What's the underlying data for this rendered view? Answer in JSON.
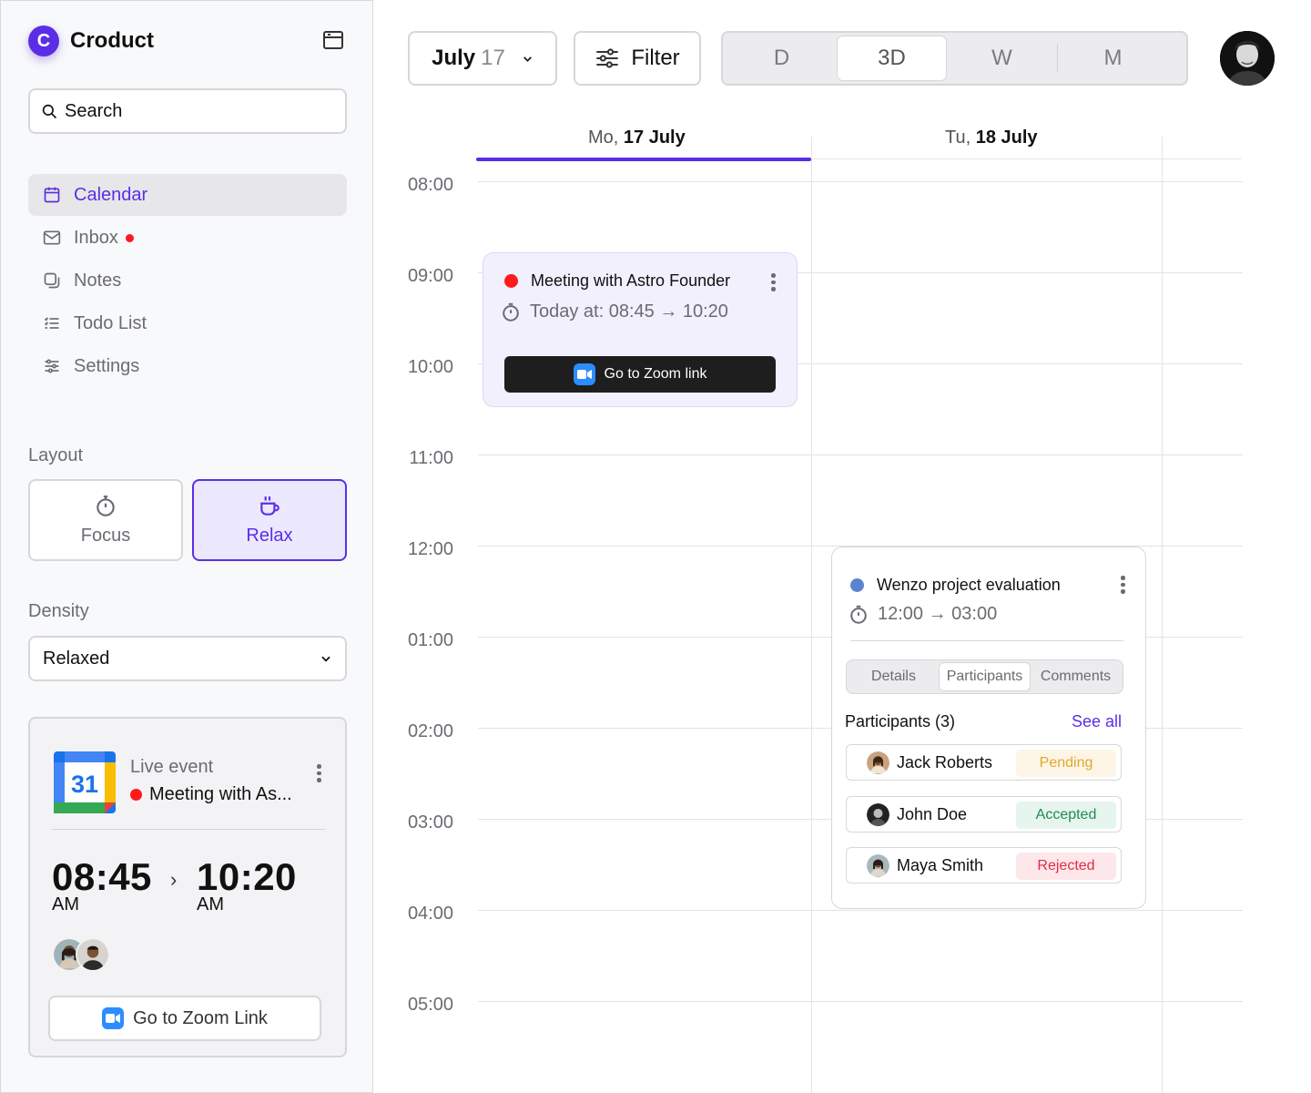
{
  "app": {
    "name": "Croduct",
    "logo_letter": "C"
  },
  "sidebar": {
    "search": {
      "placeholder": "Search"
    },
    "nav": [
      {
        "label": "Calendar",
        "icon": "calendar-icon",
        "active": true
      },
      {
        "label": "Inbox",
        "icon": "mail-icon",
        "unread": true
      },
      {
        "label": "Notes",
        "icon": "notes-icon"
      },
      {
        "label": "Todo List",
        "icon": "todo-list-icon"
      },
      {
        "label": "Settings",
        "icon": "sliders-icon"
      }
    ],
    "layout": {
      "label": "Layout",
      "options": [
        {
          "label": "Focus",
          "icon": "stopwatch-icon",
          "selected": false
        },
        {
          "label": "Relax",
          "icon": "coffee-cup-icon",
          "selected": true
        }
      ]
    },
    "density": {
      "label": "Density",
      "value": "Relaxed"
    },
    "live_event": {
      "calendar_day": "31",
      "label": "Live event",
      "title": "Meeting with As...",
      "start_time": "08:45",
      "start_ampm": "AM",
      "end_time": "10:20",
      "end_ampm": "AM",
      "zoom_label": "Go to Zoom Link"
    }
  },
  "toolbar": {
    "month": "July",
    "day": "17",
    "filter_label": "Filter",
    "views": [
      "D",
      "3D",
      "W",
      "M"
    ],
    "active_view": "3D"
  },
  "calendar": {
    "days": [
      {
        "weekday": "Mo,",
        "date": "17 July",
        "today": true
      },
      {
        "weekday": "Tu,",
        "date": "18 July",
        "today": false
      }
    ],
    "hours": [
      "08:00",
      "09:00",
      "10:00",
      "11:00",
      "12:00",
      "01:00",
      "02:00",
      "03:00",
      "04:00",
      "05:00"
    ],
    "events": [
      {
        "title": "Meeting with Astro Founder",
        "time": "Today at: 08:45 → 10:20",
        "color": "#ff1a1a",
        "zoom_label": "Go to Zoom link"
      },
      {
        "title": "Wenzo project evaluation",
        "time": "12:00 → 03:00",
        "color": "#5b84d0",
        "tabs": [
          "Details",
          "Participants",
          "Comments"
        ],
        "active_tab": "Participants",
        "participants_label": "Participants (3)",
        "see_all": "See all",
        "participants": [
          {
            "name": "Jack Roberts",
            "status": "Pending"
          },
          {
            "name": "John Doe",
            "status": "Accepted"
          },
          {
            "name": "Maya Smith",
            "status": "Rejected"
          }
        ]
      }
    ]
  },
  "colors": {
    "accent": "#5b2ee6",
    "live_dot": "#ff1a1a"
  }
}
